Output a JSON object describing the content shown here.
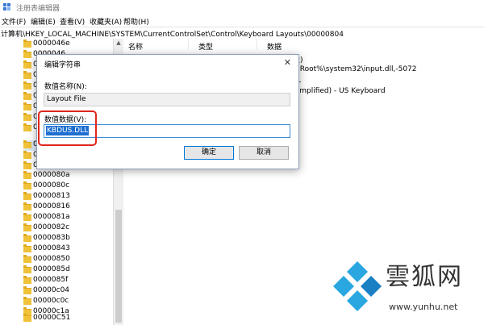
{
  "window": {
    "title": "注册表编辑器"
  },
  "menu": [
    "文件(F)",
    "编辑(E)",
    "查看(V)",
    "收藏夹(A)",
    "帮助(H)"
  ],
  "address": {
    "path": "计算机\\HKEY_LOCAL_MACHINE\\SYSTEM\\CurrentControlSet\\Control\\Keyboard Layouts\\00000804"
  },
  "tree": {
    "top_items": [
      "0000046e",
      "0000046"
    ],
    "partial_items": [
      "0",
      "0",
      "0",
      "0",
      "0",
      "0",
      "0",
      "0",
      "0",
      "0"
    ],
    "items": [
      "0000080a",
      "0000080c",
      "00000813",
      "00000816",
      "0000081a",
      "0000082c",
      "0000083b",
      "00000843",
      "00000850",
      "0000085d",
      "0000085f",
      "00000c04",
      "00000c0c",
      "00000c1a",
      "00000C51"
    ]
  },
  "list": {
    "headers": [
      "名称",
      "类型",
      "数据"
    ],
    "rows": [
      "置)",
      "mRoot%\\system32\\input.dll,-5072",
      "LL",
      "Simplified) - US Keyboard"
    ]
  },
  "dialog": {
    "title": "编辑字符串",
    "name_label": "数值名称(N):",
    "name_value": "Layout File",
    "data_label": "数值数据(V):",
    "data_value": "KBDUS.DLL",
    "ok_label": "确定",
    "cancel_label": "取消",
    "close_glyph": "✕"
  },
  "watermark": {
    "brand": "雲狐网",
    "url": "www.yunhu.net"
  }
}
